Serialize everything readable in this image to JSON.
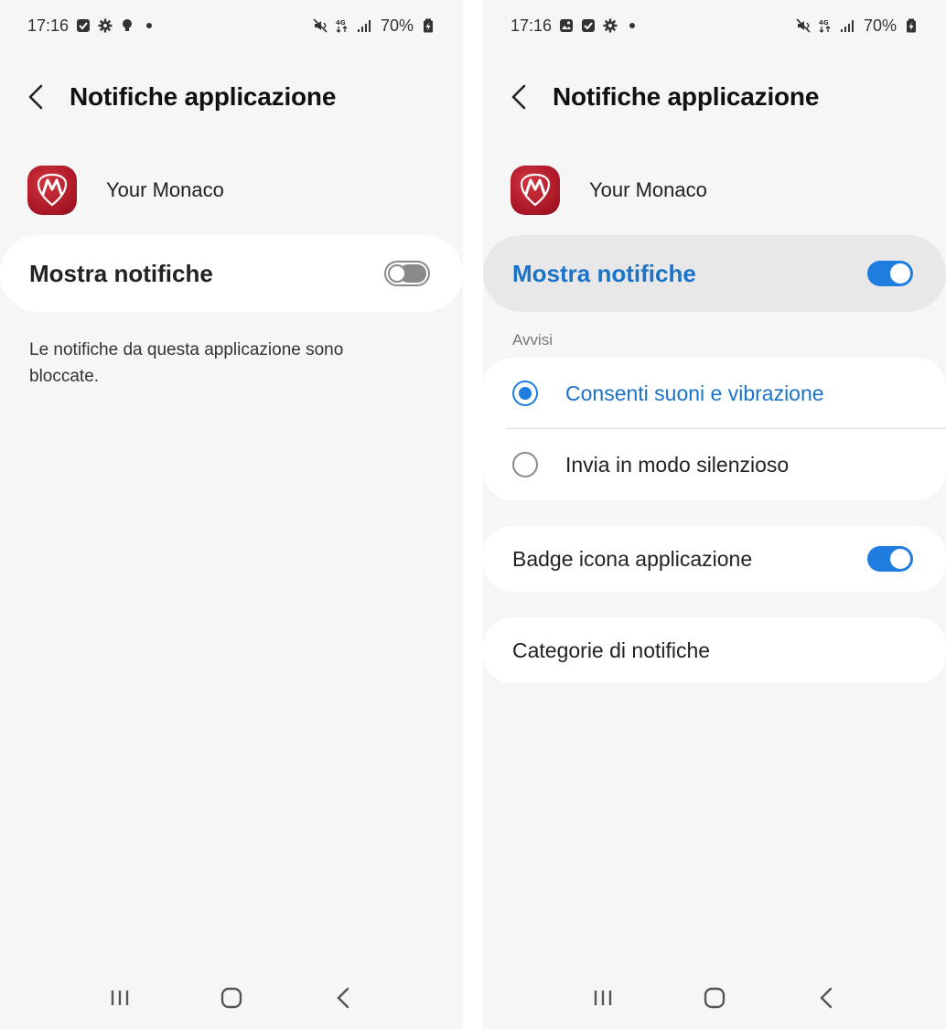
{
  "colors": {
    "accent": "#1f7de0",
    "accent_text": "#1a73c8",
    "app_icon": "#b01c2a",
    "background": "#f6f6f6"
  },
  "left": {
    "status": {
      "time": "17:16",
      "left_icons": [
        "checkbox-notification-icon",
        "gear-icon",
        "bulb-icon",
        "dot-icon"
      ],
      "right_icons": [
        "mute-vibrate-icon",
        "4g-icon",
        "signal-icon"
      ],
      "battery": "70%"
    },
    "header": {
      "title": "Notifiche applicazione"
    },
    "app": {
      "name": "Your Monaco"
    },
    "main_toggle": {
      "label": "Mostra notifiche",
      "state": "off"
    },
    "blocked_message": "Le notifiche da questa applicazione sono bloccate."
  },
  "right": {
    "status": {
      "time": "17:16",
      "left_icons": [
        "image-notification-icon",
        "checkbox-notification-icon",
        "gear-icon",
        "dot-icon"
      ],
      "right_icons": [
        "mute-vibrate-icon",
        "4g-icon",
        "signal-icon"
      ],
      "battery": "70%"
    },
    "header": {
      "title": "Notifiche applicazione"
    },
    "app": {
      "name": "Your Monaco"
    },
    "main_toggle": {
      "label": "Mostra notifiche",
      "state": "on"
    },
    "alerts": {
      "section_label": "Avvisi",
      "options": [
        {
          "label": "Consenti suoni e vibrazione",
          "selected": true
        },
        {
          "label": "Invia in modo silenzioso",
          "selected": false
        }
      ]
    },
    "badge": {
      "label": "Badge icona applicazione",
      "state": "on"
    },
    "categories": {
      "label": "Categorie di notifiche"
    }
  }
}
